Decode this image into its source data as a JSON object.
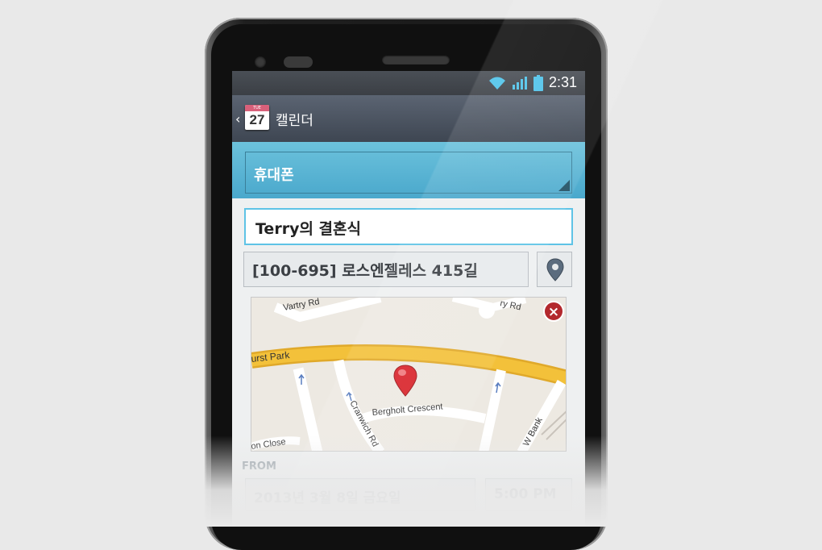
{
  "status_bar": {
    "time": "2:31",
    "icons": [
      "wifi-icon",
      "signal-icon",
      "battery-icon"
    ]
  },
  "action_bar": {
    "app_title": "캘린더",
    "calendar_icon": {
      "weekday": "TUE",
      "day": "27"
    }
  },
  "account": {
    "label": "휴대폰"
  },
  "event": {
    "title": "Terry의 결혼식",
    "location": "[100-695] 로스엔젤레스 415길"
  },
  "map": {
    "streets": [
      "Vartry Rd",
      "urst Park",
      "Bergholt Crescent",
      "Cranwich Rd",
      "W Bank",
      "on Close",
      "ry Rd"
    ]
  },
  "schedule": {
    "from_label": "FROM",
    "date": "2013년 3월 8일 금요일",
    "time": "5:00 PM"
  },
  "colors": {
    "accent": "#5ec3e6",
    "account_bar": "#4aa8cc",
    "action_bar": "#4a5360",
    "map_road": "#f3c13a",
    "map_pin": "#d8232a"
  }
}
